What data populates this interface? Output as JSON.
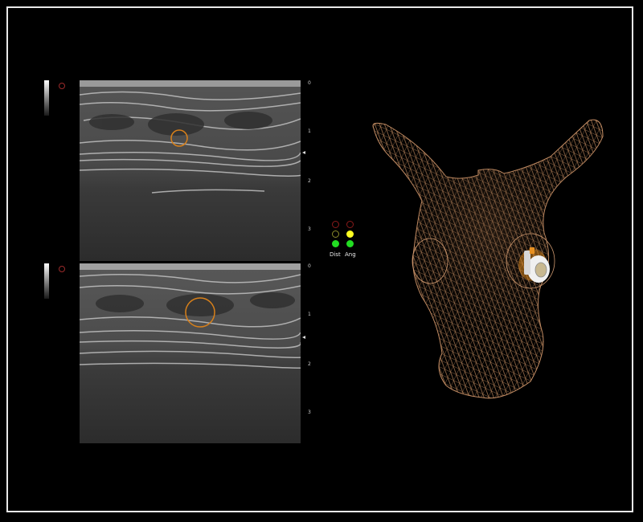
{
  "window": {
    "background": "#000000",
    "frame_color": "#e8e8e8"
  },
  "top_panel": {
    "depth_labels": [
      "0",
      "1",
      "2",
      "3"
    ],
    "icons": [
      "grayscale-bar",
      "probe-orientation-icon",
      "focus-marker"
    ]
  },
  "bottom_panel": {
    "depth_labels": [
      "0",
      "1",
      "2",
      "3"
    ],
    "icons": [
      "grayscale-bar",
      "probe-orientation-icon",
      "focus-marker"
    ]
  },
  "indicators": {
    "dist_label": "Dist",
    "ang_label": "Ang",
    "dist_states": [
      "#8a1a1a",
      "#8a8a2a",
      "#22dd22"
    ],
    "ang_states": [
      "#8a1a1a",
      "#ffff22",
      "#22dd22"
    ],
    "state_fill": [
      "none",
      "none",
      "filled"
    ],
    "state_fill_ang": [
      "none",
      "filled",
      "filled"
    ]
  },
  "model": {
    "icons": [
      "wireframe-torso-model",
      "ultrasound-probe-icon"
    ],
    "mesh_color": "#b8845a",
    "probe_color": "#f0f0f0",
    "marker_color": "#e89020"
  },
  "target_marker_color": "#d8801a"
}
